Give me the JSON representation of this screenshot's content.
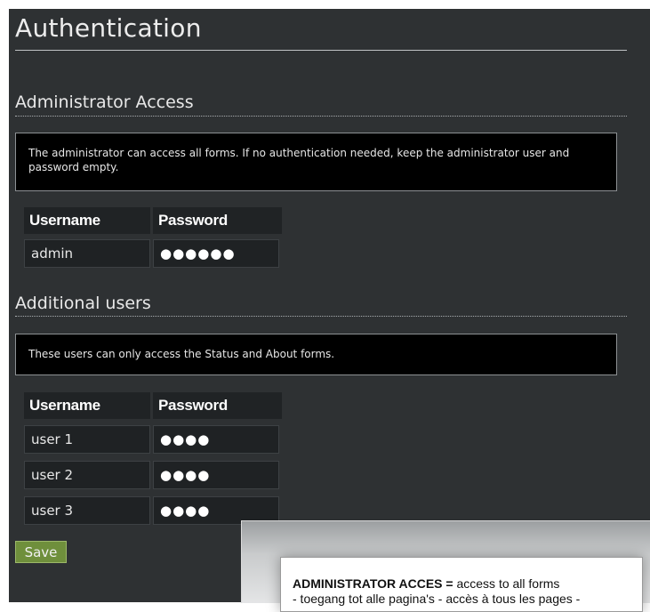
{
  "page": {
    "title": "Authentication"
  },
  "admin_section": {
    "title": "Administrator Access",
    "info": "The administrator can access all forms. If no authentication needed, keep the administrator user and password empty.",
    "headers": {
      "username": "Username",
      "password": "Password"
    },
    "rows": [
      {
        "username": "admin",
        "password": "●●●●●●"
      }
    ]
  },
  "users_section": {
    "title": "Additional users",
    "info": "These users can only access the Status and About forms.",
    "headers": {
      "username": "Username",
      "password": "Password"
    },
    "rows": [
      {
        "username": "user 1",
        "password": "●●●●"
      },
      {
        "username": "user 2",
        "password": "●●●●"
      },
      {
        "username": "user 3",
        "password": "●●●●"
      }
    ]
  },
  "actions": {
    "save_label": "Save"
  },
  "annotation": {
    "bold_text": "ADMINISTRATOR ACCES =",
    "text": " access to all forms",
    "line2": "- toegang tot alle pagina's - accès à tous les pages -"
  },
  "colors": {
    "panel_bg": "#2e3133",
    "info_bg": "#000000",
    "save_button": "#6f8f3c"
  }
}
